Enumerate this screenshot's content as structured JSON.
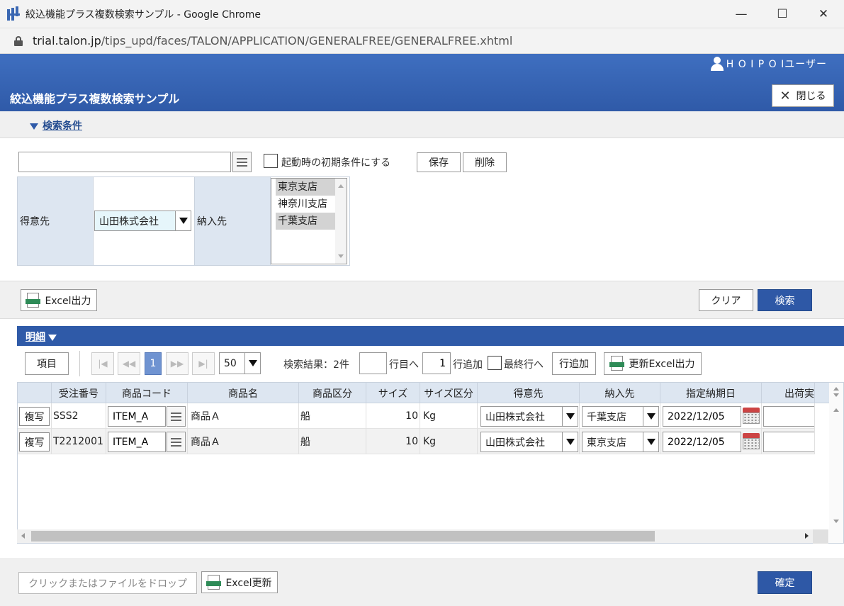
{
  "window": {
    "title": "絞込機能プラス複数検索サンプル - Google Chrome",
    "url_host": "trial.talon.jp",
    "url_path": "/tips_upd/faces/TALON/APPLICATION/GENERALFREE/GENERALFREE.xhtml"
  },
  "header": {
    "user": "H O I P O Iユーザー",
    "page_title": "絞込機能プラス複数検索サンプル",
    "close_label": "閉じる"
  },
  "search": {
    "section_label": "検索条件",
    "condition_name_value": "",
    "startup_checkbox_label": "起動時の初期条件にする",
    "save_label": "保存",
    "delete_label": "削除",
    "customer_label": "得意先",
    "customer_value": "山田株式会社",
    "delivery_label": "納入先",
    "delivery_options": [
      {
        "label": "東京支店",
        "selected": true
      },
      {
        "label": "神奈川支店",
        "selected": false
      },
      {
        "label": "千葉支店",
        "selected": true
      }
    ],
    "excel_export_label": "Excel出力",
    "clear_label": "クリア",
    "search_label": "検索"
  },
  "detail": {
    "section_label": "明細",
    "items_label": "項目",
    "current_page": "1",
    "page_size": "50",
    "result_text": "検索結果：2件",
    "goto_row_value": "",
    "goto_row_suffix": "行目へ",
    "add_rows_value": "1",
    "add_rows_suffix": "行追加",
    "last_row_label": "最終行へ",
    "add_row_button": "行追加",
    "update_excel_label": "更新Excel出力",
    "columns": [
      "受注番号",
      "商品コード",
      "商品名",
      "商品区分",
      "サイズ",
      "サイズ区分",
      "得意先",
      "納入先",
      "指定納期日",
      "出荷実"
    ],
    "copy_label": "複写",
    "rows": [
      {
        "order_no": "SSS2",
        "item_code": "ITEM_A",
        "item_name": "商品Ａ",
        "item_type": "船",
        "size": "10",
        "size_unit": "Kg",
        "customer": "山田株式会社",
        "delivery": "千葉支店",
        "due_date": "2022/12/05",
        "shipped": ""
      },
      {
        "order_no": "T2212001",
        "item_code": "ITEM_A",
        "item_name": "商品Ａ",
        "item_type": "船",
        "size": "10",
        "size_unit": "Kg",
        "customer": "山田株式会社",
        "delivery": "東京支店",
        "due_date": "2022/12/05",
        "shipped": ""
      }
    ]
  },
  "footer": {
    "dropzone_label": "クリックまたはファイルをドロップ",
    "excel_update_label": "Excel更新",
    "confirm_label": "確定"
  }
}
